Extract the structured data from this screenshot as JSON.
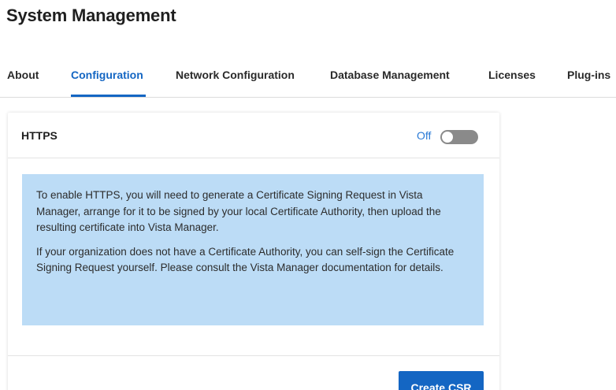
{
  "page": {
    "title": "System Management"
  },
  "tabs": [
    {
      "label": "About",
      "active": false
    },
    {
      "label": "Configuration",
      "active": true
    },
    {
      "label": "Network Configuration",
      "active": false
    },
    {
      "label": "Database Management",
      "active": false
    },
    {
      "label": "Licenses",
      "active": false
    },
    {
      "label": "Plug-ins",
      "active": false
    }
  ],
  "https_card": {
    "title": "HTTPS",
    "toggle": {
      "label": "Off",
      "state": "off"
    },
    "info": {
      "paragraph1": "To enable HTTPS, you will need to generate a Certificate Signing Request in Vista Manager, arrange for it to be signed by your local Certificate Authority, then upload the resulting certificate into Vista Manager.",
      "paragraph2": "If your organization does not have a Certificate Authority, you can self-sign the Certificate Signing Request yourself. Please consult the Vista Manager documentation for details."
    },
    "create_csr_label": "Create CSR"
  },
  "colors": {
    "accent": "#1466c3",
    "toggle_label": "#2b7bd6",
    "info_background": "#bcdcf6",
    "toggle_off": "#8a8a8a"
  }
}
